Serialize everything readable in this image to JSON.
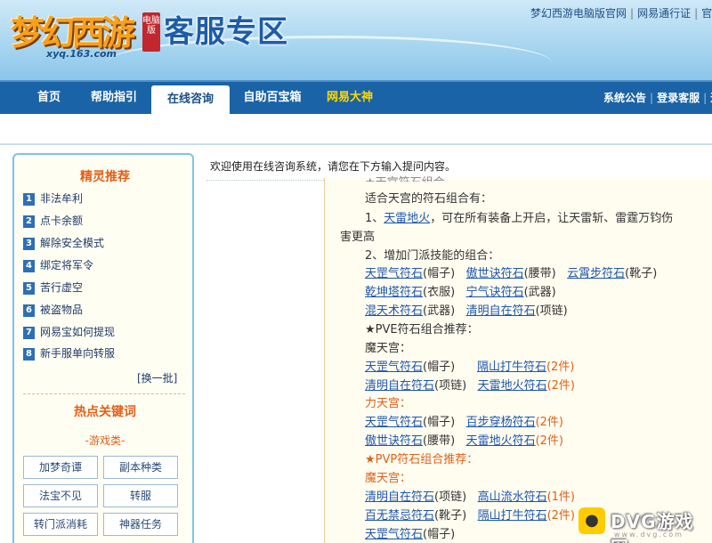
{
  "header": {
    "logo_text": "梦幻西游",
    "logo_badge": "电脑版",
    "logo_url": "xyq.163.com",
    "zone_title": "客服专区",
    "top_links": [
      "梦幻西游电脑版官网",
      "网易通行证",
      "官方"
    ]
  },
  "nav": {
    "items": [
      "首页",
      "帮助指引",
      "在线咨询",
      "自助百宝箱",
      "网易大神"
    ],
    "active": "在线咨询",
    "right_links": [
      "系统公告",
      "登录客服",
      "退"
    ]
  },
  "sidebar": {
    "recommend_title": "精灵推荐",
    "items": [
      {
        "num": "1",
        "label": "非法牟利"
      },
      {
        "num": "2",
        "label": "点卡余额"
      },
      {
        "num": "3",
        "label": "解除安全模式"
      },
      {
        "num": "4",
        "label": "绑定将军令"
      },
      {
        "num": "5",
        "label": "苦行虚空"
      },
      {
        "num": "6",
        "label": "被盗物品"
      },
      {
        "num": "7",
        "label": "网易宝如何提现"
      },
      {
        "num": "8",
        "label": "新手服单向转服"
      }
    ],
    "refresh_label": "[换一批]",
    "hot_title": "热点关键词",
    "category_label": "-游戏类-",
    "keywords": [
      "加梦奇谭",
      "副本种类",
      "法宝不见",
      "转服",
      "转门派消耗",
      "神器任务"
    ]
  },
  "content": {
    "welcome": "欢迎使用在线咨询系统，请您在下方输入提问内容。",
    "answer": {
      "partial_top": "★天宫符石组合",
      "intro": "适合天宫的符石组合有：",
      "p1_prefix": "1、",
      "p1_link": "天雷地火",
      "p1_text": "，可在所有装备上开启，让天雷斩、雷霆万钧伤",
      "p1_text2": "害更高",
      "p2": "2、增加门派技能的组合：",
      "row1": [
        [
          "天罡气符石",
          "(帽子)"
        ],
        [
          "傲世诀符石",
          "(腰带)"
        ],
        [
          "云霄步符石",
          "(靴子)"
        ]
      ],
      "row2": [
        [
          "乾坤塔符石",
          "(衣服)"
        ],
        [
          "宁气诀符石",
          "(武器)"
        ]
      ],
      "row3": [
        [
          "混天术符石",
          "(武器)"
        ],
        [
          "清明自在符石",
          "(项链)"
        ]
      ],
      "pve_title": "★PVE符石组合推荐：",
      "mo_title": "魔天宫：",
      "pve_mo1": [
        [
          "天罡气符石",
          "(帽子)"
        ],
        [
          "隔山打牛符石",
          "(2件)"
        ]
      ],
      "pve_mo2": [
        [
          "清明自在符石",
          "(项链)"
        ],
        [
          "天雷地火符石",
          "(2件)"
        ]
      ],
      "li_title": "力天宫：",
      "pve_li1": [
        [
          "天罡气符石",
          "(帽子)"
        ],
        [
          "百步穿杨符石",
          "(2件)"
        ]
      ],
      "pve_li2": [
        [
          "傲世诀符石",
          "(腰带)"
        ],
        [
          "天雷地火符石",
          "(2件)"
        ]
      ],
      "pvp_title": "★PVP符石组合推荐：",
      "pvp_mo_title": "魔天宫：",
      "pvp1": [
        [
          "清明自在符石",
          "(项链)"
        ],
        [
          "高山流水符石",
          "(1件)"
        ]
      ],
      "pvp2": [
        [
          "百无禁忌符石",
          "(靴子)"
        ],
        [
          "隔山打牛符石",
          "(2件)"
        ]
      ],
      "pvp3": [
        [
          "天罡气符石",
          "(帽子)"
        ]
      ]
    }
  },
  "watermark": {
    "text": "DVG游戏网",
    "sub": "www.dvg.com"
  }
}
